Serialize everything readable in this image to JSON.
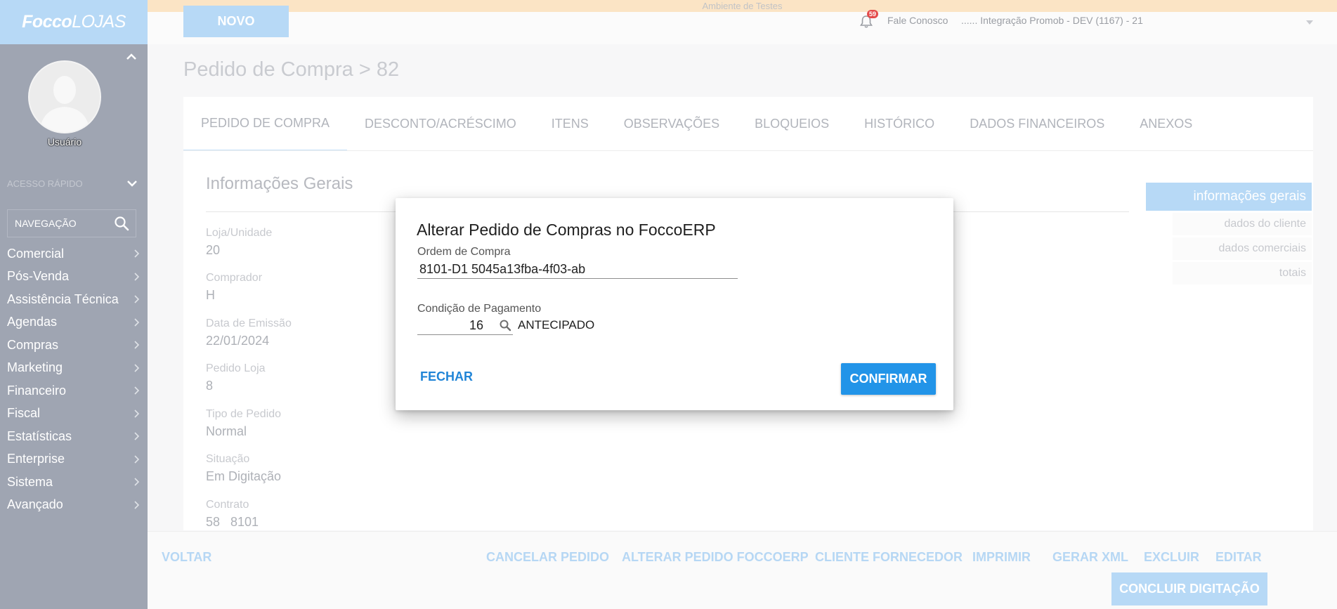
{
  "app": {
    "logo_bold": "Focco",
    "logo_light": "LOJAS",
    "environment_banner": "Ambiente de Testes"
  },
  "sidebar": {
    "user_name": "Usuário",
    "quick_access_label": "ACESSO RÁPIDO",
    "nav_search_label": "NAVEGAÇÃO",
    "menu": [
      {
        "label": "Comercial"
      },
      {
        "label": "Pós-Venda"
      },
      {
        "label": "Assistência Técnica"
      },
      {
        "label": "Agendas"
      },
      {
        "label": "Compras"
      },
      {
        "label": "Marketing"
      },
      {
        "label": "Financeiro"
      },
      {
        "label": "Fiscal"
      },
      {
        "label": "Estatísticas"
      },
      {
        "label": "Enterprise"
      },
      {
        "label": "Sistema"
      },
      {
        "label": "Avançado"
      }
    ]
  },
  "topbar": {
    "new_button": "NOVO",
    "notification_count": "59",
    "contact_link": "Fale Conosco",
    "company": "...... Integração Promob - DEV (1167) - 21"
  },
  "page": {
    "title": "Pedido de Compra > 82",
    "tabs": [
      {
        "label": "PEDIDO DE COMPRA",
        "active": true
      },
      {
        "label": "DESCONTO/ACRÉSCIMO"
      },
      {
        "label": "ITENS"
      },
      {
        "label": "OBSERVAÇÕES"
      },
      {
        "label": "BLOQUEIOS"
      },
      {
        "label": "HISTÓRICO"
      },
      {
        "label": "DADOS FINANCEIROS"
      },
      {
        "label": "ANEXOS"
      }
    ],
    "section_title": "Informações Gerais",
    "fields": [
      {
        "label": "Loja/Unidade",
        "value": "20"
      },
      {
        "label": "Comprador",
        "value": "H"
      },
      {
        "label": "Data de Emissão",
        "value": "22/01/2024"
      },
      {
        "label": "Pedido Loja",
        "value": "8"
      },
      {
        "label": "Tipo de Pedido",
        "value": "Normal"
      },
      {
        "label": "Situação",
        "value": "Em Digitação"
      },
      {
        "label": "Contrato",
        "value": "58   8101"
      }
    ],
    "right_nav": {
      "active": "informações gerais",
      "items": [
        "dados do cliente",
        "dados comerciais",
        "totais"
      ]
    }
  },
  "actions": {
    "back": "VOLTAR",
    "cancel_order": "CANCELAR PEDIDO",
    "change_order": "ALTERAR PEDIDO FOCCOERP",
    "client_supplier": "CLIENTE FORNECEDOR",
    "print": "IMPRIMIR",
    "generate_xml": "GERAR XML",
    "delete": "EXCLUIR",
    "edit": "EDITAR",
    "finish_typing": "CONCLUIR DIGITAÇÃO"
  },
  "dialog": {
    "title": "Alterar Pedido de Compras no FoccoERP",
    "purchase_order_label": "Ordem de Compra",
    "purchase_order_value": "8101-D1 5045a13fba-4f03-ab",
    "payment_condition_label": "Condição de Pagamento",
    "payment_condition_code": "16",
    "payment_condition_desc": "ANTECIPADO",
    "close_button": "FECHAR",
    "confirm_button": "CONFIRMAR"
  },
  "colors": {
    "sidebar_bg": "#9fa5b2",
    "accent_light": "#b7d9f6",
    "confirm_button": "#2294e8",
    "link_blue": "#2185d7",
    "env_banner": "#fbe4c5",
    "badge_red": "#e44b4b"
  },
  "icons": [
    "chevron-up-icon",
    "user-avatar-icon",
    "chevron-down-icon",
    "search-icon",
    "chevron-right-icon",
    "bell-icon",
    "caret-down-icon"
  ]
}
